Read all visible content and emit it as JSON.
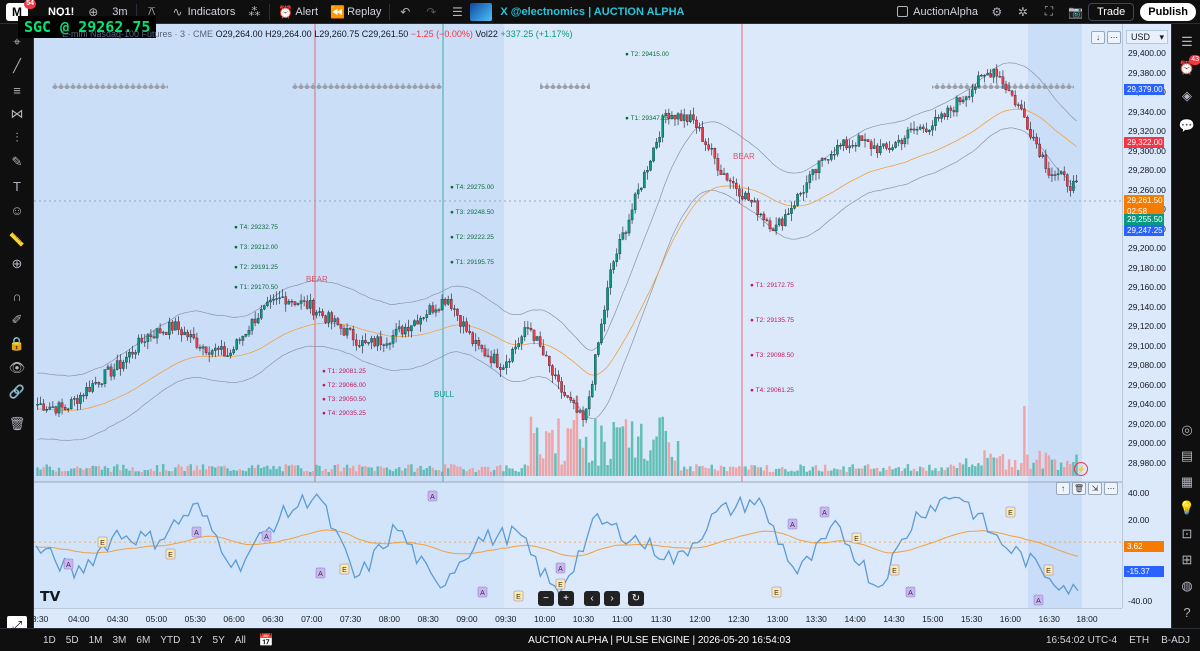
{
  "topbar": {
    "logo_letter": "M",
    "logo_badge": "54",
    "symbol": "NQ1!",
    "timeframe": "3m",
    "indicators_label": "Indicators",
    "alert_label": "Alert",
    "replay_label": "Replay",
    "brand_text": "X @electnomics  |  AUCTION ALPHA",
    "layout_name": "AuctionAlpha",
    "trade_label": "Trade",
    "publish_label": "Publish"
  },
  "right_toolbar": {
    "notification_badge": "43"
  },
  "overlay": {
    "sgc_text": "SGC @ 29262.75",
    "legend_title": "E-mini Nasdaq-100 Futures · 3 · CME",
    "ohlc_o": "O29,264.00",
    "ohlc_h": "H29,264.00",
    "ohlc_l": "L29,260.75",
    "ohlc_c": "C29,261.50",
    "ohlc_chg": "−1.25 (−0.00%)",
    "vol": "Vol22",
    "vol_chg": "+337.25 (+1.17%)"
  },
  "price_scale": {
    "currency": "USD",
    "ticks": [
      "29,420.00",
      "29,380.00",
      "29,340.00",
      "29,300.00",
      "29,260.00",
      "29,220.00",
      "29,180.00",
      "29,140.00",
      "29,100.00",
      "29,060.00",
      "29,020.00",
      "28,980.00"
    ],
    "ticks_mid": [
      "29,400.00",
      "29,360.00",
      "29,320.00",
      "29,280.00",
      "29,240.00",
      "29,200.00",
      "29,160.00",
      "29,120.00",
      "29,080.00",
      "29,040.00",
      "29,000.00"
    ],
    "tags": [
      {
        "text": "29,379.00",
        "color": "#2962ff"
      },
      {
        "text": "29,322.00",
        "color": "#f23645"
      },
      {
        "text": "29,261.50",
        "color": "#f57c00"
      },
      {
        "text": "02:58",
        "color": "#f57c00"
      },
      {
        "text": "29,255.50",
        "color": "#089981"
      },
      {
        "text": "29,247.25",
        "color": "#2962ff"
      }
    ]
  },
  "indicator_scale": {
    "ticks": [
      "40.00",
      "20.00",
      "0.00",
      "-20.00",
      "-40.00"
    ],
    "tags": [
      {
        "text": "3.62",
        "color": "#f57c00"
      },
      {
        "text": "-15.37",
        "color": "#2962ff"
      }
    ]
  },
  "annotations": {
    "bear1": "BEAR",
    "bear2": "BEAR",
    "bull1": "BULL",
    "targets_a": [
      "T4: 29232.75",
      "T3: 29212.00",
      "T2: 29191.25",
      "T1: 29170.50"
    ],
    "targets_b": [
      "T1: 29081.25",
      "T2: 29066.00",
      "T3: 29050.50",
      "T4: 29035.25"
    ],
    "targets_c": [
      "T4: 29275.00",
      "T3: 29248.50",
      "T2: 29222.25",
      "T1: 29195.75"
    ],
    "targets_d": [
      "T2: 29415.00",
      "T1: 29347.25"
    ],
    "targets_e": [
      "T1: 29172.75",
      "T2: 29135.75",
      "T3: 29098.50",
      "T4: 29061.25"
    ]
  },
  "time_axis": {
    "labels": [
      "3:30",
      "04:00",
      "04:30",
      "05:00",
      "05:30",
      "06:00",
      "06:30",
      "07:00",
      "07:30",
      "08:00",
      "08:30",
      "09:00",
      "09:30",
      "10:00",
      "10:30",
      "11:00",
      "11:30",
      "12:00",
      "12:30",
      "13:00",
      "13:30",
      "14:00",
      "14:30",
      "15:00",
      "15:30",
      "16:00",
      "16:30",
      "18:00"
    ]
  },
  "bottombar": {
    "ranges": [
      "1D",
      "5D",
      "1M",
      "3M",
      "6M",
      "YTD",
      "1Y",
      "5Y",
      "All"
    ],
    "status_text": "AUCTION ALPHA | PULSE ENGINE | 2026-05-20 16:54:03",
    "clock": "16:54:02 UTC-4",
    "session": "ETH",
    "adj": "B-ADJ"
  },
  "colors": {
    "up": "#089981",
    "down": "#f23645",
    "bg": "#dbe9fb",
    "osc": "#5b9bd5",
    "osc_signal": "#f0a040"
  },
  "chart_data": {
    "type": "candlestick",
    "symbol": "NQ1!",
    "ylim": [
      28960,
      29430
    ],
    "x_labels": [
      "04:00",
      "05:00",
      "06:00",
      "07:00",
      "08:00",
      "09:00",
      "10:00",
      "11:00",
      "12:00",
      "13:00",
      "14:00",
      "15:00",
      "16:00"
    ],
    "close_path": [
      29040,
      29035,
      29060,
      29080,
      29110,
      29120,
      29100,
      29090,
      29130,
      29150,
      29140,
      29120,
      29100,
      29110,
      29130,
      29150,
      29100,
      29080,
      29120,
      29060,
      29020,
      29180,
      29260,
      29340,
      29330,
      29280,
      29250,
      29220,
      29260,
      29300,
      29310,
      29300,
      29320,
      29330,
      29360,
      29385,
      29340,
      29280,
      29262
    ],
    "oscillator": {
      "ylim": [
        -45,
        45
      ],
      "values": [
        0,
        -20,
        10,
        5,
        30,
        -15,
        20,
        40,
        -25,
        15,
        -30,
        5,
        10,
        -35,
        20,
        5,
        -10,
        25,
        35,
        -20,
        15,
        -30,
        25,
        40,
        5,
        -15,
        -35
      ]
    }
  }
}
